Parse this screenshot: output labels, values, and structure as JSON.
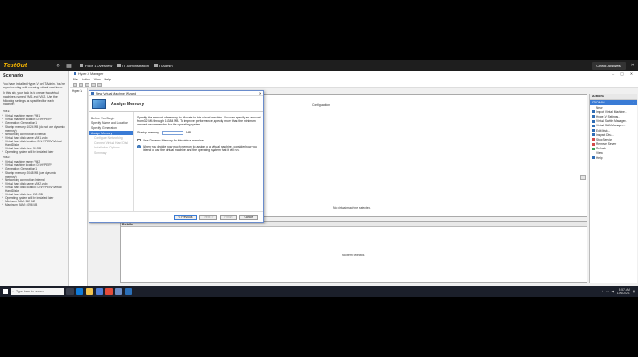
{
  "testout_bar": {
    "logo": "TestOut",
    "items": [
      "Floor 1 Overview",
      "IT Administration",
      "ITAdmin"
    ],
    "check_button": "Check Answers"
  },
  "scenario": {
    "title": "Scenario",
    "paragraphs": [
      "You have installed Hyper-V on ITAdmin. You're experimenting with creating virtual machines.",
      "In this lab, your task is to create two virtual machines named VM1 and VM2. Use the following settings as specified for each machine:"
    ],
    "vm1_heading": "VM1:",
    "vm1_items": [
      "Virtual machine name: VM1",
      "Virtual machine location: D:\\HYPERV",
      "Generation: Generation 1",
      "Startup memory: 1024 MB (do not use dynamic memory)",
      "Networking connection: External",
      "Virtual hard disk name: VM1.vhdx",
      "Virtual hard disk location: D:\\HYPERV\\Virtual Hard Disks",
      "Virtual hard disk size: 50 GB",
      "Operating system will be installed later"
    ],
    "vm2_heading": "VM2:",
    "vm2_items": [
      "Virtual machine name: VM2",
      "Virtual machine location: D:\\HYPERV",
      "Generation: Generation 1",
      "Startup memory: 2048 MB (use dynamic memory)",
      "Networking connection: Internal",
      "Virtual hard disk name: VM2.vhdx",
      "Virtual hard disk location: D:\\HYPERV\\Virtual Hard Disks",
      "Virtual hard disk size: 250 GB",
      "Operating system will be installed later",
      "Minimum RAM: 512 MB",
      "Maximum RAM: 4096 MB"
    ]
  },
  "hyperv": {
    "title": "Hyper-V Manager",
    "menu": [
      "File",
      "Action",
      "View",
      "Help"
    ],
    "tree_item": "Hyper-V",
    "vm_columns": [
      "Name",
      "State",
      "CPU Usage",
      "Assigned Memory",
      "Uptime",
      "Status",
      "Configuration"
    ],
    "no_vm_selected": "No virtual machine selected.",
    "details_header": "Details",
    "no_item_selected": "No item selected."
  },
  "actions": {
    "title": "Actions",
    "group": "ITADMIN",
    "items": [
      {
        "label": "New",
        "icon": "none"
      },
      {
        "label": "Import Virtual Machine...",
        "icon": "blue"
      },
      {
        "label": "Hyper-V Settings...",
        "icon": "blue"
      },
      {
        "label": "Virtual Switch Manager...",
        "icon": "blue"
      },
      {
        "label": "Virtual SAN Manager...",
        "icon": "blue"
      },
      {
        "label": "Edit Disk...",
        "icon": "blue"
      },
      {
        "label": "Inspect Disk...",
        "icon": "blue"
      },
      {
        "label": "Stop Service",
        "icon": "red"
      },
      {
        "label": "Remove Server",
        "icon": "red"
      },
      {
        "label": "Refresh",
        "icon": "green"
      },
      {
        "label": "View",
        "icon": "none"
      },
      {
        "label": "Help",
        "icon": "blue"
      }
    ]
  },
  "wizard": {
    "title": "New Virtual Machine Wizard",
    "heading": "Assign Memory",
    "steps": [
      {
        "label": "Before You Begin",
        "state": "normal"
      },
      {
        "label": "Specify Name and Location",
        "state": "normal"
      },
      {
        "label": "Specify Generation",
        "state": "normal"
      },
      {
        "label": "Assign Memory",
        "state": "active"
      },
      {
        "label": "Configure Networking",
        "state": "disabled"
      },
      {
        "label": "Connect Virtual Hard Disk",
        "state": "disabled"
      },
      {
        "label": "Installation Options",
        "state": "disabled"
      },
      {
        "label": "Summary",
        "state": "disabled"
      }
    ],
    "description": "Specify the amount of memory to allocate to this virtual machine. You can specify an amount from 32 MB through 16384 MB. To improve performance, specify more than the minimum amount recommended for the operating system.",
    "startup_label": "Startup memory:",
    "startup_value": "",
    "unit": "MB",
    "dynamic_label": "Use Dynamic Memory for this virtual machine.",
    "info": "When you decide how much memory to assign to a virtual machine, consider how you intend to use the virtual machine and the operating system that it will run.",
    "buttons": {
      "previous": "< Previous",
      "next": "Next >",
      "finish": "Finish",
      "cancel": "Cancel"
    }
  },
  "taskbar": {
    "search_placeholder": "Type here to search",
    "time": "8:57 AM",
    "date": "12/6/2021"
  }
}
